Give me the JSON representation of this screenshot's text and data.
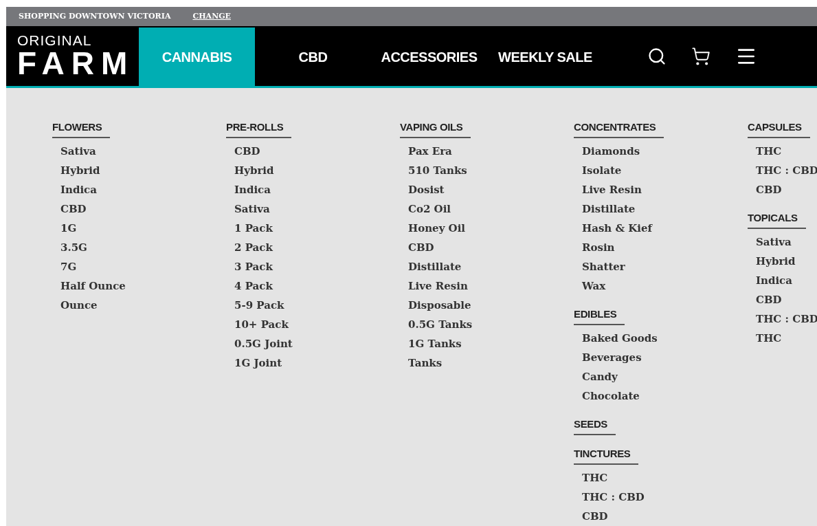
{
  "top_bar": {
    "location": "SHOPPING DOWNTOWN VICTORIA",
    "change_link": "CHANGE"
  },
  "logo": {
    "line1": "ORIGINAL",
    "line2": "FARM"
  },
  "nav": [
    {
      "label": "CANNABIS",
      "selected": true
    },
    {
      "label": "CBD",
      "selected": false
    },
    {
      "label": "ACCESSORIES",
      "selected": false
    },
    {
      "label": "WEEKLY SALE",
      "selected": false
    }
  ],
  "menu": {
    "columns": [
      [
        {
          "heading": "FLOWERS",
          "items": [
            "Sativa",
            "Hybrid",
            "Indica",
            "CBD",
            "1G",
            "3.5G",
            "7G",
            "Half Ounce",
            "Ounce"
          ]
        }
      ],
      [
        {
          "heading": "PRE-ROLLS",
          "items": [
            "CBD",
            "Hybrid",
            "Indica",
            "Sativa",
            "1 Pack",
            "2 Pack",
            "3 Pack",
            "4 Pack",
            "5-9 Pack",
            "10+ Pack",
            "0.5G Joint",
            "1G Joint"
          ]
        }
      ],
      [
        {
          "heading": "VAPING OILS",
          "items": [
            "Pax Era",
            "510 Tanks",
            "Dosist",
            "Co2 Oil",
            "Honey Oil",
            "CBD",
            "Distillate",
            "Live Resin",
            "Disposable",
            "0.5G Tanks",
            "1G Tanks",
            "Tanks"
          ]
        }
      ],
      [
        {
          "heading": "CONCENTRATES",
          "items": [
            "Diamonds",
            "Isolate",
            "Live Resin",
            "Distillate",
            "Hash & Kief",
            "Rosin",
            "Shatter",
            "Wax"
          ]
        },
        {
          "heading": "EDIBLES",
          "items": [
            "Baked Goods",
            "Beverages",
            "Candy",
            "Chocolate"
          ]
        },
        {
          "heading": "SEEDS"
        },
        {
          "heading": "TINCTURES",
          "items": [
            "THC",
            "THC : CBD",
            "CBD"
          ]
        }
      ],
      [
        {
          "heading": "CAPSULES",
          "items": [
            "THC",
            "THC : CBD",
            "CBD"
          ]
        },
        {
          "heading": "TOPICALS",
          "items": [
            "Sativa",
            "Hybrid",
            "Indica",
            "CBD",
            "THC : CBD",
            "THC"
          ]
        }
      ]
    ]
  }
}
